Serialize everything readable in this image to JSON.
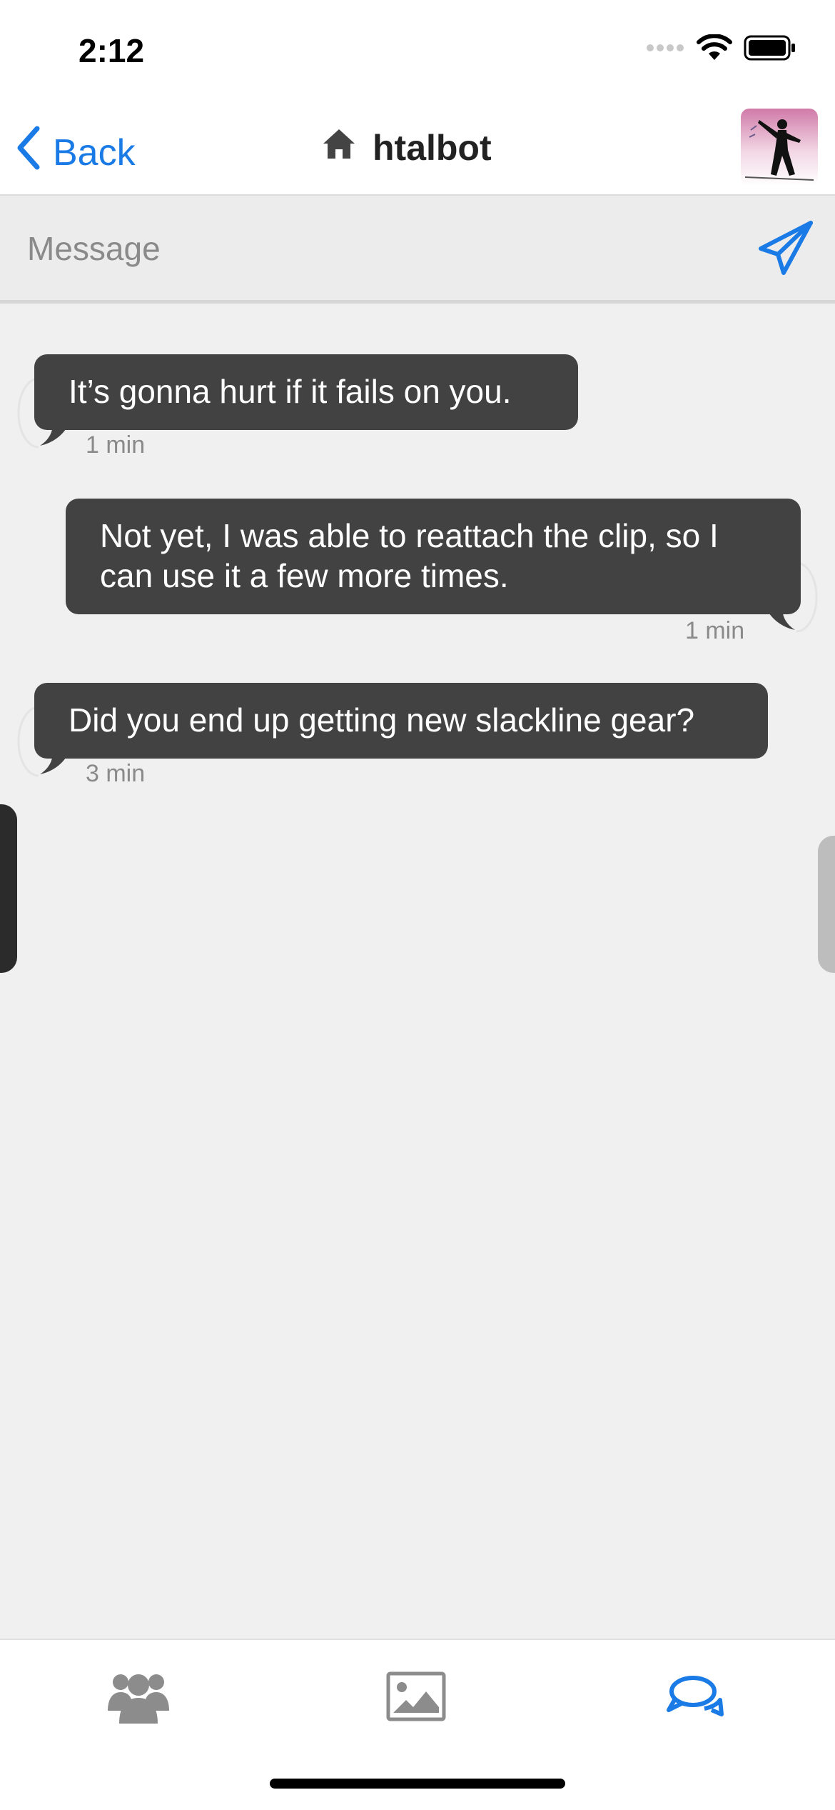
{
  "status_bar": {
    "time": "2:12"
  },
  "nav": {
    "back_label": "Back",
    "title": "htalbot"
  },
  "compose": {
    "placeholder": "Message"
  },
  "messages": [
    {
      "text": "It’s gonna hurt if it fails on you.",
      "time": "1 min",
      "side": "incoming"
    },
    {
      "text": "Not yet, I was able to reattach the clip, so I can use it a few more times.",
      "time": "1 min",
      "side": "outgoing"
    },
    {
      "text": "Did you end up getting new slackline gear?",
      "time": "3 min",
      "side": "incoming"
    }
  ],
  "tabs": [
    {
      "icon": "users-icon",
      "active": false
    },
    {
      "icon": "image-icon",
      "active": false
    },
    {
      "icon": "chat-icon",
      "active": true
    }
  ],
  "colors": {
    "accent": "#1a7ae6",
    "bubble": "#424242",
    "background": "#f0f0f0",
    "inactive_icon": "#8c8c8c"
  }
}
